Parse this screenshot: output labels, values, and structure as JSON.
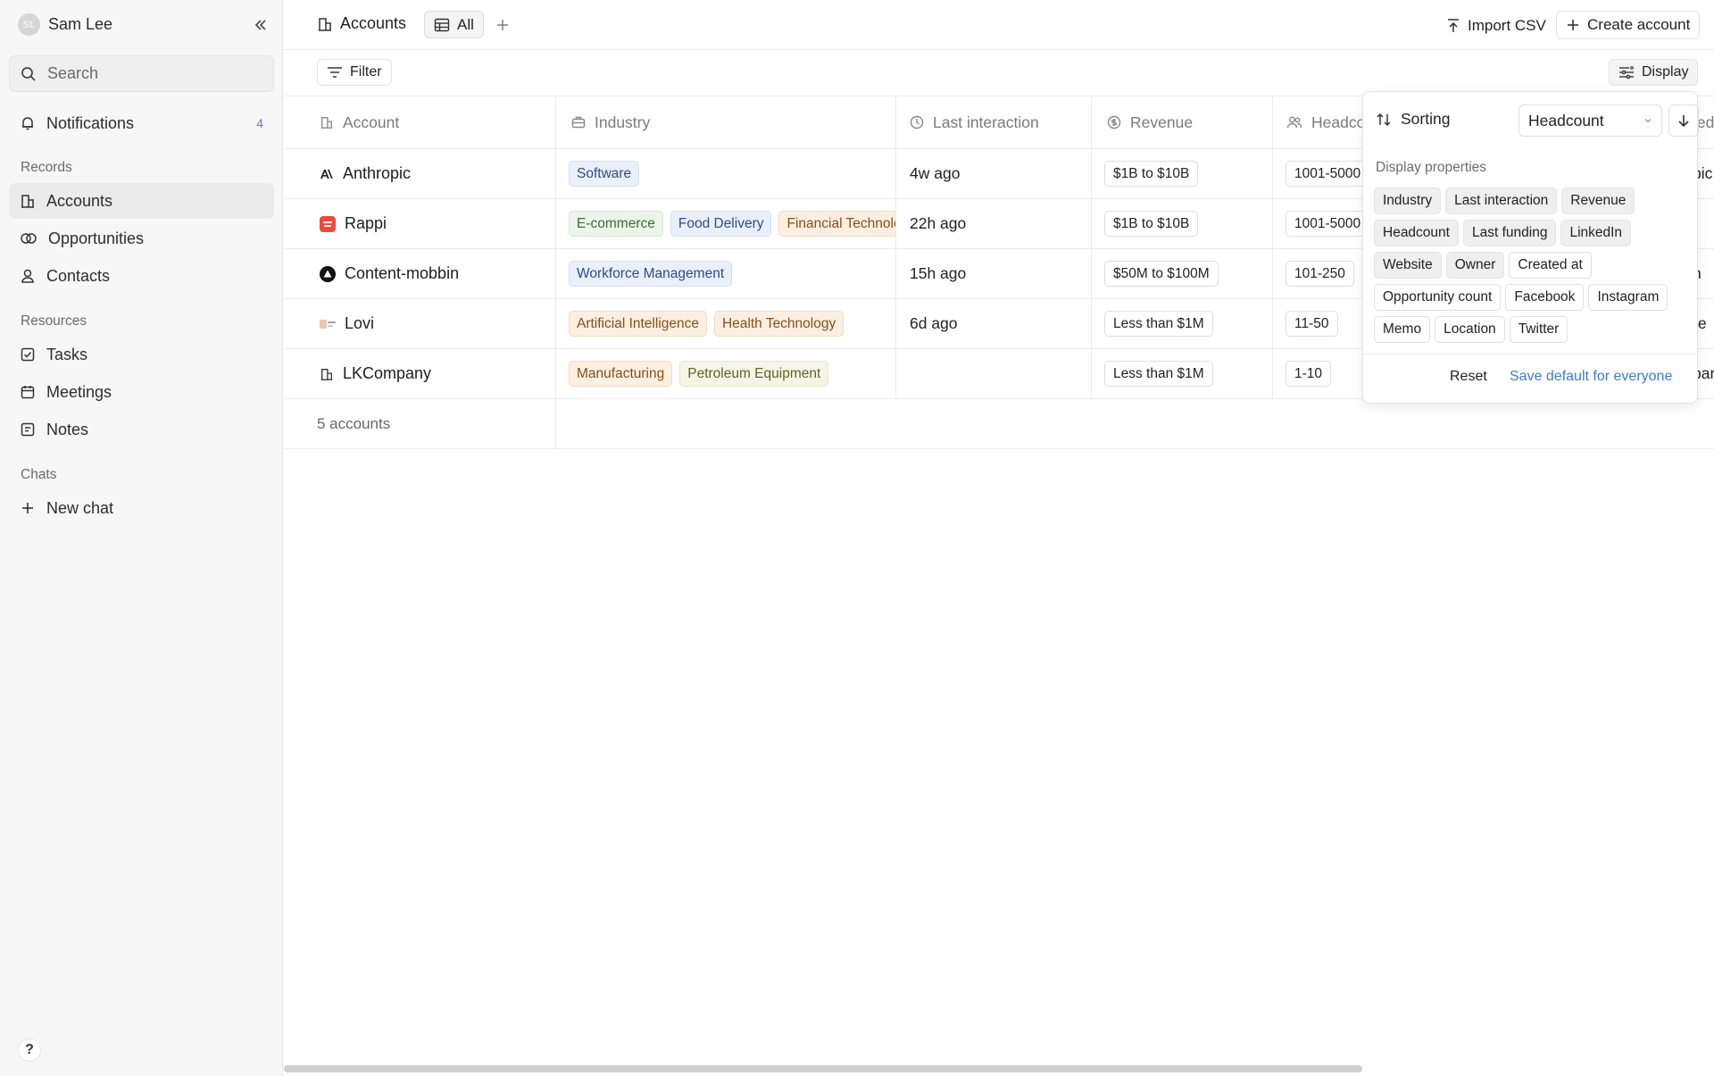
{
  "sidebar": {
    "user": {
      "initials": "SL",
      "name": "Sam Lee"
    },
    "search_placeholder": "Search",
    "notifications": {
      "label": "Notifications",
      "count": "4"
    },
    "records_label": "Records",
    "records": [
      {
        "label": "Accounts",
        "icon": "building-icon"
      },
      {
        "label": "Opportunities",
        "icon": "opportunity-icon"
      },
      {
        "label": "Contacts",
        "icon": "person-icon"
      }
    ],
    "resources_label": "Resources",
    "resources": [
      {
        "label": "Tasks",
        "icon": "checkbox-icon"
      },
      {
        "label": "Meetings",
        "icon": "calendar-icon"
      },
      {
        "label": "Notes",
        "icon": "note-icon"
      }
    ],
    "chats_label": "Chats",
    "new_chat": "New chat",
    "help": "?"
  },
  "header": {
    "title": "Accounts",
    "view_tab": "All",
    "import_label": "Import CSV",
    "create_label": "Create account"
  },
  "toolbar": {
    "filter_label": "Filter",
    "display_label": "Display"
  },
  "table": {
    "columns": [
      "Account",
      "Industry",
      "Last interaction",
      "Revenue",
      "Headcount"
    ],
    "rows": [
      {
        "account": "Anthropic",
        "industries": [
          "Software"
        ],
        "last": "4w ago",
        "revenue": "$1B to $10B",
        "headcount": "1001-5000",
        "overflow": "pic"
      },
      {
        "account": "Rappi",
        "industries": [
          "E-commerce",
          "Food Delivery",
          "Financial Technology"
        ],
        "last": "22h ago",
        "revenue": "$1B to $10B",
        "headcount": "1001-5000",
        "overflow": ""
      },
      {
        "account": "Content-mobbin",
        "industries": [
          "Workforce Management"
        ],
        "last": "15h ago",
        "revenue": "$50M to $100M",
        "headcount": "101-250",
        "overflow": "n"
      },
      {
        "account": "Lovi",
        "industries": [
          "Artificial Intelligence",
          "Health Technology"
        ],
        "last": "6d ago",
        "revenue": "Less than $1M",
        "headcount": "11-50",
        "overflow": "re"
      },
      {
        "account": "LKCompany",
        "industries": [
          "Manufacturing",
          "Petroleum Equipment"
        ],
        "last": "",
        "revenue": "Less than $1M",
        "headcount": "1-10",
        "overflow": "par"
      }
    ],
    "footer": "5 accounts",
    "overflow_header": "ted"
  },
  "display_panel": {
    "sorting_label": "Sorting",
    "sort_value": "Headcount",
    "properties_label": "Display properties",
    "properties": [
      {
        "label": "Industry",
        "on": true
      },
      {
        "label": "Last interaction",
        "on": true
      },
      {
        "label": "Revenue",
        "on": true
      },
      {
        "label": "Headcount",
        "on": true
      },
      {
        "label": "Last funding",
        "on": true
      },
      {
        "label": "LinkedIn",
        "on": true
      },
      {
        "label": "Website",
        "on": true
      },
      {
        "label": "Owner",
        "on": true
      },
      {
        "label": "Created at",
        "on": false
      },
      {
        "label": "Opportunity count",
        "on": false
      },
      {
        "label": "Facebook",
        "on": false
      },
      {
        "label": "Instagram",
        "on": false
      },
      {
        "label": "Memo",
        "on": false
      },
      {
        "label": "Location",
        "on": false
      },
      {
        "label": "Twitter",
        "on": false
      }
    ],
    "reset_label": "Reset",
    "save_label": "Save default for everyone"
  },
  "colors": {
    "accent": "#3c7bd6",
    "badge": "#5b7ec7"
  }
}
